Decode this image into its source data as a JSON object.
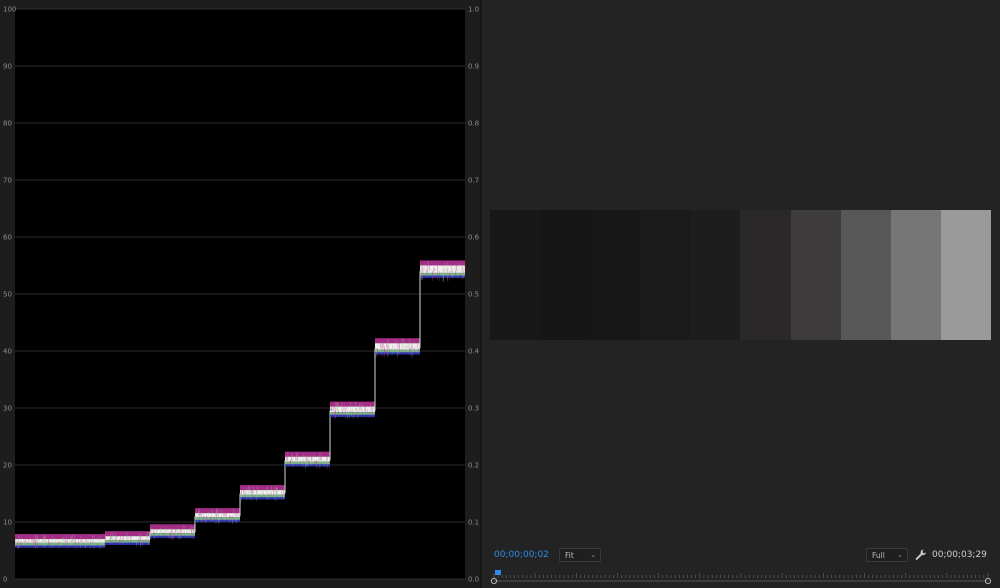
{
  "scope": {
    "left_scale": [
      "0",
      "10",
      "20",
      "30",
      "40",
      "50",
      "60",
      "70",
      "80",
      "90",
      "100"
    ],
    "right_scale": [
      "0.0",
      "0.1",
      "0.2",
      "0.3",
      "0.4",
      "0.5",
      "0.6",
      "0.7",
      "0.8",
      "0.9",
      "1.0"
    ],
    "step_levels": [
      6.5,
      6.5,
      7.0,
      8.2,
      11.0,
      15.0,
      20.8,
      29.5,
      40.5,
      54.0
    ],
    "trace_colors": {
      "magenta": "#c0359e",
      "white": "#f0f0ec",
      "green": "#8fcf9a",
      "blue": "#3340d0"
    }
  },
  "monitor": {
    "frame_strips": [
      "#181818",
      "#161616",
      "#171717",
      "#1a1a1a",
      "#1e1d1e",
      "#2a2829",
      "#3d3b3c",
      "#575757",
      "#767676",
      "#9a9a9a"
    ],
    "timecode_current": "00;00;00;02",
    "zoom_value": "Fit",
    "quality_value": "Full",
    "timecode_duration": "00;00;03;29",
    "playhead_color": "#2d8ceb"
  }
}
